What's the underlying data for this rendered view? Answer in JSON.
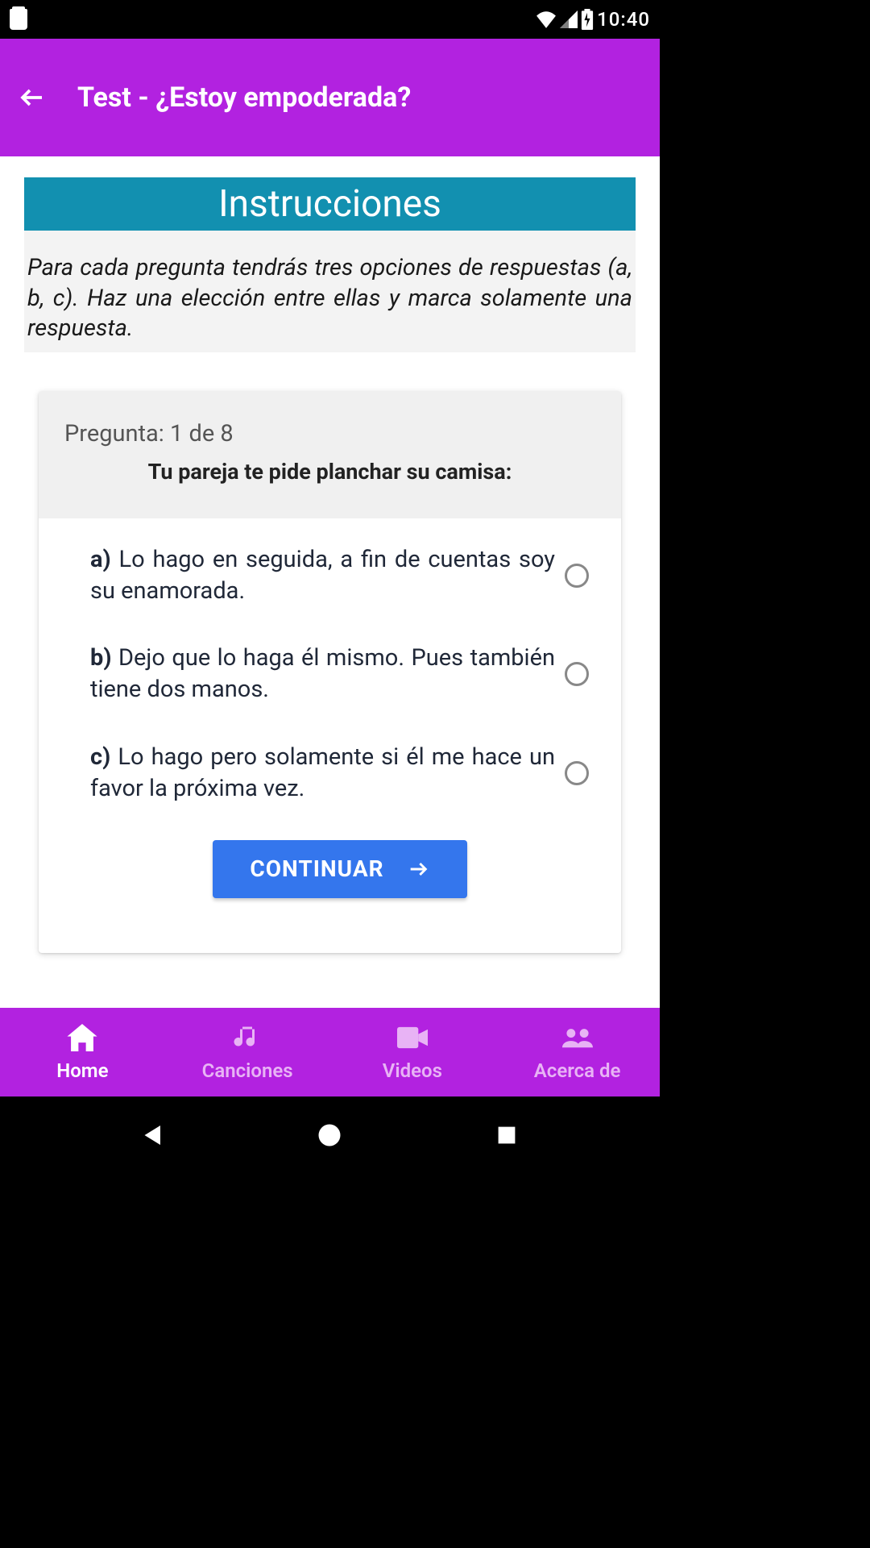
{
  "status": {
    "time": "10:40"
  },
  "appbar": {
    "title": "Test - ¿Estoy empoderada?"
  },
  "instructions": {
    "header": "Instrucciones",
    "text": "Para cada pregunta tendrás tres opciones de respuestas (a, b, c). Haz una elección entre ellas y marca solamente una respuesta."
  },
  "question": {
    "counter": "Pregunta: 1 de 8",
    "text": "Tu pareja te pide planchar su camisa:",
    "options": [
      {
        "label": "a)",
        "text": "Lo hago en seguida, a fin de cuentas soy su enamorada."
      },
      {
        "label": "b)",
        "text": "Dejo que lo haga él mismo. Pues también tiene dos manos."
      },
      {
        "label": "c)",
        "text": "Lo hago pero solamente si él me hace un favor la próxima vez."
      }
    ],
    "continue": "CONTINUAR"
  },
  "nav": {
    "items": [
      {
        "label": "Home",
        "active": true
      },
      {
        "label": "Canciones",
        "active": false
      },
      {
        "label": "Videos",
        "active": false
      },
      {
        "label": "Acerca de",
        "active": false
      }
    ]
  }
}
